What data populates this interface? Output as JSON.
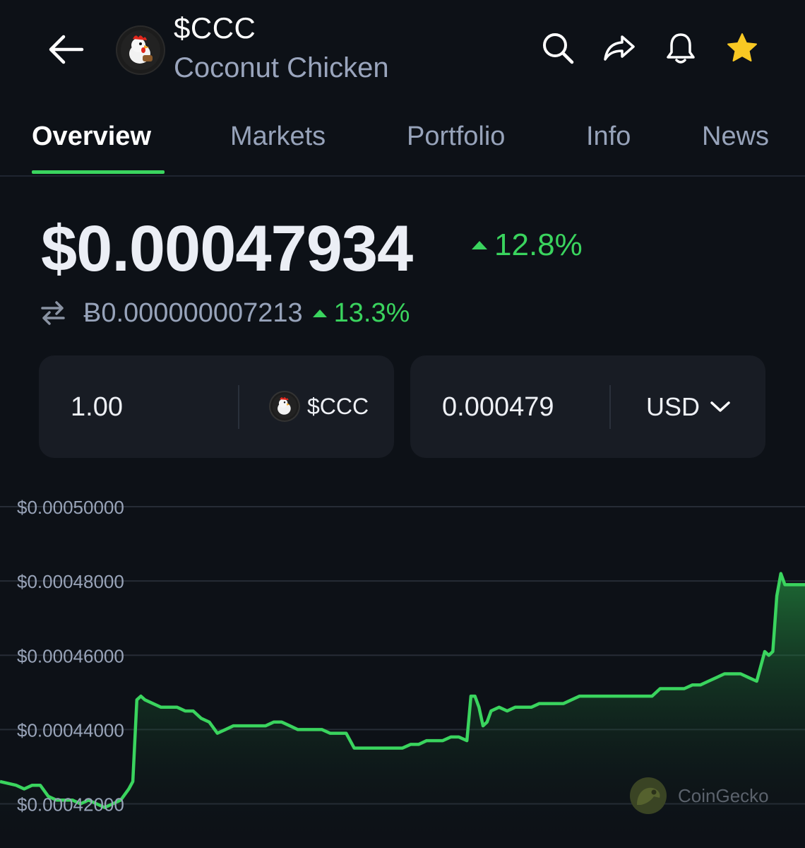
{
  "header": {
    "ticker": "$CCC",
    "coin_name": "Coconut Chicken",
    "icons": [
      "back-arrow-icon",
      "search-icon",
      "share-icon",
      "bell-icon",
      "star-icon"
    ],
    "star_color": "#f8c823"
  },
  "tabs": [
    "Overview",
    "Markets",
    "Portfolio",
    "Info",
    "News"
  ],
  "active_tab": "Overview",
  "price": {
    "usd": "$0.00047934",
    "usd_change": "12.8%",
    "btc": "Ƀ0.000000007213",
    "btc_change": "13.3%",
    "change_color": "#3ad45e"
  },
  "converter": {
    "amount": "1.00",
    "token": "$CCC",
    "result": "0.000479",
    "currency": "USD"
  },
  "chart_data": {
    "type": "area",
    "y_tick_labels": [
      "$0.00050000",
      "$0.00048000",
      "$0.00046000",
      "$0.00044000",
      "$0.00042000"
    ],
    "y_ticks": [
      0.0005,
      0.00048,
      0.00046,
      0.00044,
      0.00042
    ],
    "ylim": [
      0.00041,
      0.000512
    ],
    "xlim": [
      0,
      100
    ],
    "grid": true,
    "color": "#3ad45e",
    "x": [
      0,
      2,
      3,
      4,
      5,
      6,
      7,
      8,
      9,
      10,
      11,
      12,
      13,
      14,
      15,
      16,
      16.5,
      17,
      17.5,
      18,
      19,
      20,
      21,
      22,
      23,
      24,
      25,
      26,
      27,
      28,
      29,
      30,
      31,
      32,
      33,
      34,
      35,
      36,
      37,
      38,
      39,
      40,
      41,
      42,
      43,
      44,
      45,
      46,
      47,
      48,
      49,
      50,
      51,
      52,
      53,
      54,
      55,
      56,
      57,
      58,
      58.5,
      59,
      59.5,
      60,
      60.5,
      61,
      62,
      63,
      64,
      65,
      66,
      67,
      68,
      69,
      70,
      71,
      72,
      73,
      74,
      75,
      76,
      77,
      78,
      79,
      80,
      81,
      82,
      83,
      84,
      85,
      86,
      87,
      88,
      89,
      90,
      91,
      92,
      93,
      94,
      95,
      95.5,
      96,
      96.5,
      97,
      97.5,
      98,
      99,
      100
    ],
    "values": [
      0.000426,
      0.000425,
      0.000424,
      0.000425,
      0.000425,
      0.000422,
      0.000421,
      0.000421,
      0.000421,
      0.00042,
      0.000421,
      0.00042,
      0.000419,
      0.00042,
      0.000421,
      0.000424,
      0.000426,
      0.000448,
      0.000449,
      0.000448,
      0.000447,
      0.000446,
      0.000446,
      0.000446,
      0.000445,
      0.000445,
      0.000443,
      0.000442,
      0.000439,
      0.00044,
      0.000441,
      0.000441,
      0.000441,
      0.000441,
      0.000441,
      0.000442,
      0.000442,
      0.000441,
      0.00044,
      0.00044,
      0.00044,
      0.00044,
      0.000439,
      0.000439,
      0.000439,
      0.000435,
      0.000435,
      0.000435,
      0.000435,
      0.000435,
      0.000435,
      0.000435,
      0.000436,
      0.000436,
      0.000437,
      0.000437,
      0.000437,
      0.000438,
      0.000438,
      0.000437,
      0.000449,
      0.000449,
      0.000446,
      0.000441,
      0.000442,
      0.000445,
      0.000446,
      0.000445,
      0.000446,
      0.000446,
      0.000446,
      0.000447,
      0.000447,
      0.000447,
      0.000447,
      0.000448,
      0.000449,
      0.000449,
      0.000449,
      0.000449,
      0.000449,
      0.000449,
      0.000449,
      0.000449,
      0.000449,
      0.000449,
      0.000451,
      0.000451,
      0.000451,
      0.000451,
      0.000452,
      0.000452,
      0.000453,
      0.000454,
      0.000455,
      0.000455,
      0.000455,
      0.000454,
      0.000453,
      0.000461,
      0.00046,
      0.000461,
      0.000476,
      0.000482,
      0.000479,
      0.000479,
      0.000479,
      0.000479
    ]
  },
  "watermark": "CoinGecko"
}
